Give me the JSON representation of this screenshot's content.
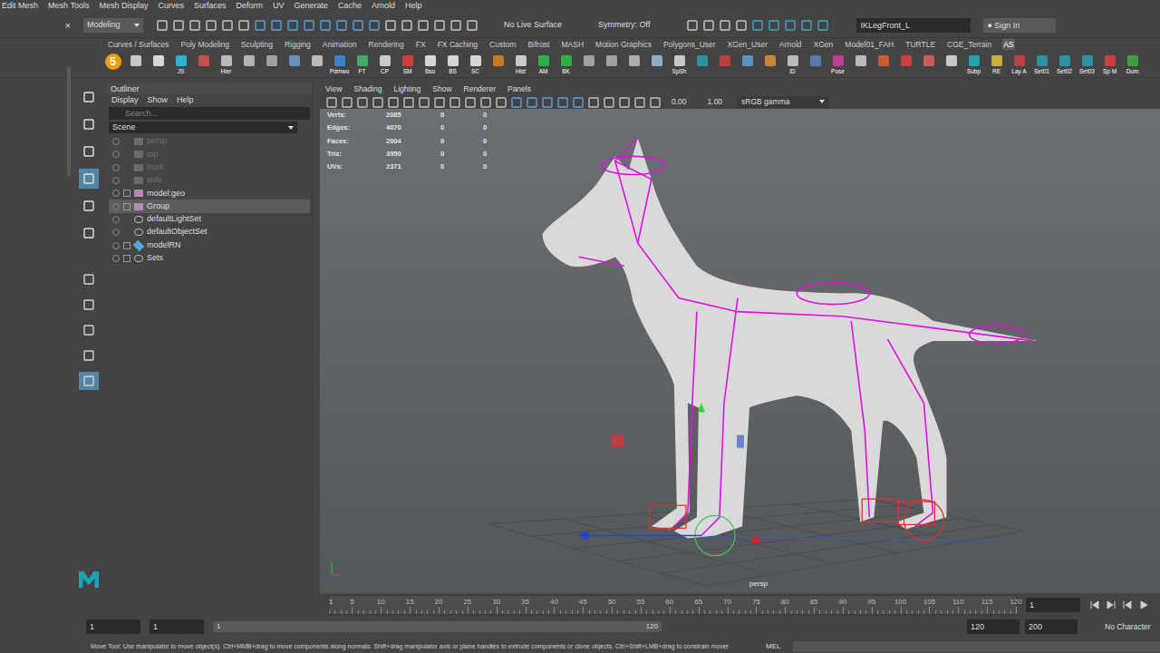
{
  "menu_bar": [
    "Edit Mesh",
    "Mesh Tools",
    "Mesh Display",
    "Curves",
    "Surfaces",
    "Deform",
    "UV",
    "Generate",
    "Cache",
    "Arnold",
    "Help"
  ],
  "status_line": {
    "mode": "Modeling",
    "live_surface": "No Live Surface",
    "symmetry": "Symmetry: Off",
    "name_field": "IKLegFront_L",
    "sign_in": "Sign In"
  },
  "left_panel": {
    "close": "×"
  },
  "shelf_tabs": [
    {
      "label": "Curves / Surfaces",
      "selected": false
    },
    {
      "label": "Poly Modeling",
      "selected": false
    },
    {
      "label": "Sculpting",
      "selected": false
    },
    {
      "label": "Rigging",
      "selected": false
    },
    {
      "label": "Animation",
      "selected": false
    },
    {
      "label": "Rendering",
      "selected": false
    },
    {
      "label": "FX",
      "selected": false
    },
    {
      "label": "FX Caching",
      "selected": false
    },
    {
      "label": "Custom",
      "selected": false
    },
    {
      "label": "Bifrost",
      "selected": false
    },
    {
      "label": "MASH",
      "selected": false
    },
    {
      "label": "Motion Graphics",
      "selected": false
    },
    {
      "label": "Polygons_User",
      "selected": false
    },
    {
      "label": "XGen_User",
      "selected": false
    },
    {
      "label": "Arnold",
      "selected": false
    },
    {
      "label": "XGen",
      "selected": false
    },
    {
      "label": "Model01_FAH",
      "selected": false
    },
    {
      "label": "TURTLE",
      "selected": false
    },
    {
      "label": "CGE_Terrain",
      "selected": false
    },
    {
      "label": "AS",
      "selected": true
    }
  ],
  "shelf_buttons": [
    {
      "label": "5",
      "color": "#f39c12"
    },
    {
      "label": "",
      "color": "#e0e0e0"
    },
    {
      "label": "",
      "color": "#f0f0f0"
    },
    {
      "label": "JS",
      "color": "#29c4e8"
    },
    {
      "label": "",
      "color": "#e05050"
    },
    {
      "label": "Hier",
      "color": "#d0d0d0"
    },
    {
      "label": "",
      "color": "#c8c8c8"
    },
    {
      "label": "",
      "color": "#b0b0b0"
    },
    {
      "label": "",
      "color": "#6fa0d0"
    },
    {
      "label": "",
      "color": "#d0d0d0"
    },
    {
      "label": "Pdmwo",
      "color": "#3a8ee0"
    },
    {
      "label": "FT",
      "color": "#40c070"
    },
    {
      "label": "CP",
      "color": "#e0e0e0"
    },
    {
      "label": "SM",
      "color": "#e04040"
    },
    {
      "label": "Bso",
      "color": "#f0f0f0"
    },
    {
      "label": "BS",
      "color": "#f0f0f0"
    },
    {
      "label": "SC",
      "color": "#f0f0f0"
    },
    {
      "label": "",
      "color": "#e08020"
    },
    {
      "label": "Hist",
      "color": "#e0e0e0"
    },
    {
      "label": "AM",
      "color": "#2ec04a"
    },
    {
      "label": "BK",
      "color": "#2ec04a"
    },
    {
      "label": "",
      "color": "#b0b0b0"
    },
    {
      "label": "",
      "color": "#b0b0b0"
    },
    {
      "label": "",
      "color": "#c0c0c0"
    },
    {
      "label": "",
      "color": "#a0c0e0"
    },
    {
      "label": "SpSh",
      "color": "#e0e0e0"
    },
    {
      "label": "",
      "color": "#2aa0b0"
    },
    {
      "label": "",
      "color": "#d04040"
    },
    {
      "label": "",
      "color": "#60a0d0"
    },
    {
      "label": "",
      "color": "#e09030"
    },
    {
      "label": "ID",
      "color": "#d0d0d0"
    },
    {
      "label": "",
      "color": "#6080c0"
    },
    {
      "label": "Pose",
      "color": "#d040a0"
    },
    {
      "label": "",
      "color": "#d0d0d0"
    },
    {
      "label": "",
      "color": "#e06030"
    },
    {
      "label": "",
      "color": "#e04040"
    },
    {
      "label": "",
      "color": "#e06060"
    },
    {
      "label": "",
      "color": "#e0e0e0"
    },
    {
      "label": "Subp",
      "color": "#20b0c0"
    },
    {
      "label": "RE",
      "color": "#e0c040"
    },
    {
      "label": "Lay A",
      "color": "#d04040"
    },
    {
      "label": "Set01",
      "color": "#2aa0b0"
    },
    {
      "label": "Set02",
      "color": "#2aa0b0"
    },
    {
      "label": "Set03",
      "color": "#2aa0b0"
    },
    {
      "label": "Sp M",
      "color": "#e04040"
    },
    {
      "label": "Dum",
      "color": "#40b040"
    }
  ],
  "outliner": {
    "title": "Outliner",
    "menu": [
      "Display",
      "Show",
      "Help"
    ],
    "search_placeholder": "Search...",
    "filter": "Scene",
    "items": [
      {
        "label": "persp",
        "kind": "camera",
        "expandable": false,
        "dimmed": true,
        "selected": false
      },
      {
        "label": "top",
        "kind": "camera",
        "expandable": false,
        "dimmed": true,
        "selected": false
      },
      {
        "label": "front",
        "kind": "camera",
        "expandable": false,
        "dimmed": true,
        "selected": false
      },
      {
        "label": "side",
        "kind": "camera",
        "expandable": false,
        "dimmed": true,
        "selected": false
      },
      {
        "label": "model:geo",
        "kind": "group",
        "expandable": true,
        "dimmed": false,
        "selected": false
      },
      {
        "label": "Group",
        "kind": "group",
        "expandable": true,
        "dimmed": false,
        "selected": true
      },
      {
        "label": "defaultLightSet",
        "kind": "set",
        "expandable": false,
        "dimmed": false,
        "selected": false
      },
      {
        "label": "defaultObjectSet",
        "kind": "set",
        "expandable": false,
        "dimmed": false,
        "selected": false
      },
      {
        "label": "modelRN",
        "kind": "reference",
        "expandable": true,
        "dimmed": false,
        "selected": false
      },
      {
        "label": "Sets",
        "kind": "set",
        "expandable": true,
        "dimmed": false,
        "selected": false
      }
    ]
  },
  "viewport": {
    "menu": [
      "View",
      "Shading",
      "Lighting",
      "Show",
      "Renderer",
      "Panels"
    ],
    "exposure": "0.00",
    "gamma": "1.00",
    "color_space": "sRGB gamma",
    "hud": [
      {
        "label": "Verts:",
        "values": [
          "2085",
          "0",
          "0"
        ]
      },
      {
        "label": "Edges:",
        "values": [
          "4070",
          "0",
          "0"
        ]
      },
      {
        "label": "Faces:",
        "values": [
          "2004",
          "0",
          "0"
        ]
      },
      {
        "label": "Tris:",
        "values": [
          "3950",
          "0",
          "0"
        ]
      },
      {
        "label": "UVs:",
        "values": [
          "2371",
          "0",
          "0"
        ]
      }
    ],
    "camera": "persp"
  },
  "timeline": {
    "first": "1",
    "ticks": [
      "5",
      "10",
      "15",
      "20",
      "25",
      "30",
      "35",
      "40",
      "45",
      "50",
      "55",
      "60",
      "65",
      "70",
      "75",
      "80",
      "85",
      "90",
      "95",
      "100",
      "105",
      "110",
      "115",
      "120"
    ],
    "current_frame": "1"
  },
  "range": {
    "start": "1",
    "range_start": "1",
    "slider_start": "1",
    "slider_end": "120",
    "range_end": "120",
    "end": "200",
    "character": "No Character"
  },
  "help_line": {
    "text": "Move Tool: Use manipulator to move object(s). Ctrl+MMB+drag to move components along normals. Shift+drag manipulator axis or plane handles to extrude components or clone objects. Ctrl+Shift+LMB+drag to constrain mover",
    "language": "MEL"
  }
}
